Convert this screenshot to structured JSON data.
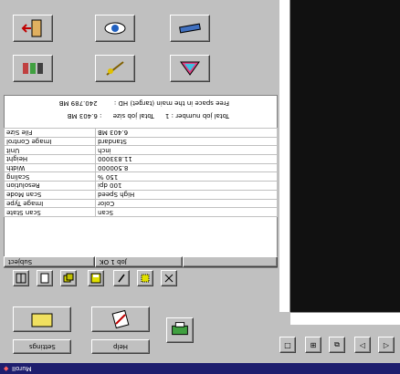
{
  "taskbar": {
    "label": "MuroII"
  },
  "info": {
    "free_space": "Free space in the main (target) HD :",
    "free_space_value": "240.789 MB",
    "total_job_number": "Total job number : 1",
    "total_job_size": "Total job size",
    "total_job_size_value": ": 6.403  MB"
  },
  "props": {
    "rows": [
      {
        "label": "File Size",
        "value": "6.403  MB"
      },
      {
        "label": "Image Control",
        "value": "Standard"
      },
      {
        "label": "Unit",
        "value": "inch"
      },
      {
        "label": "Height",
        "value": "11.833000"
      },
      {
        "label": "Width",
        "value": "8.500000"
      },
      {
        "label": "Scaling",
        "value": "150 %"
      },
      {
        "label": "Resolution",
        "value": "100 dpi"
      },
      {
        "label": "Scan Mode",
        "value": "High Speed"
      },
      {
        "label": "Image Type",
        "value": "Color"
      },
      {
        "label": "Scan State",
        "value": "Scan"
      }
    ],
    "header_subject": "Subject",
    "header_job": "Job 1   OK"
  },
  "buttons": {
    "settings": "Settings",
    "help": "Help"
  }
}
